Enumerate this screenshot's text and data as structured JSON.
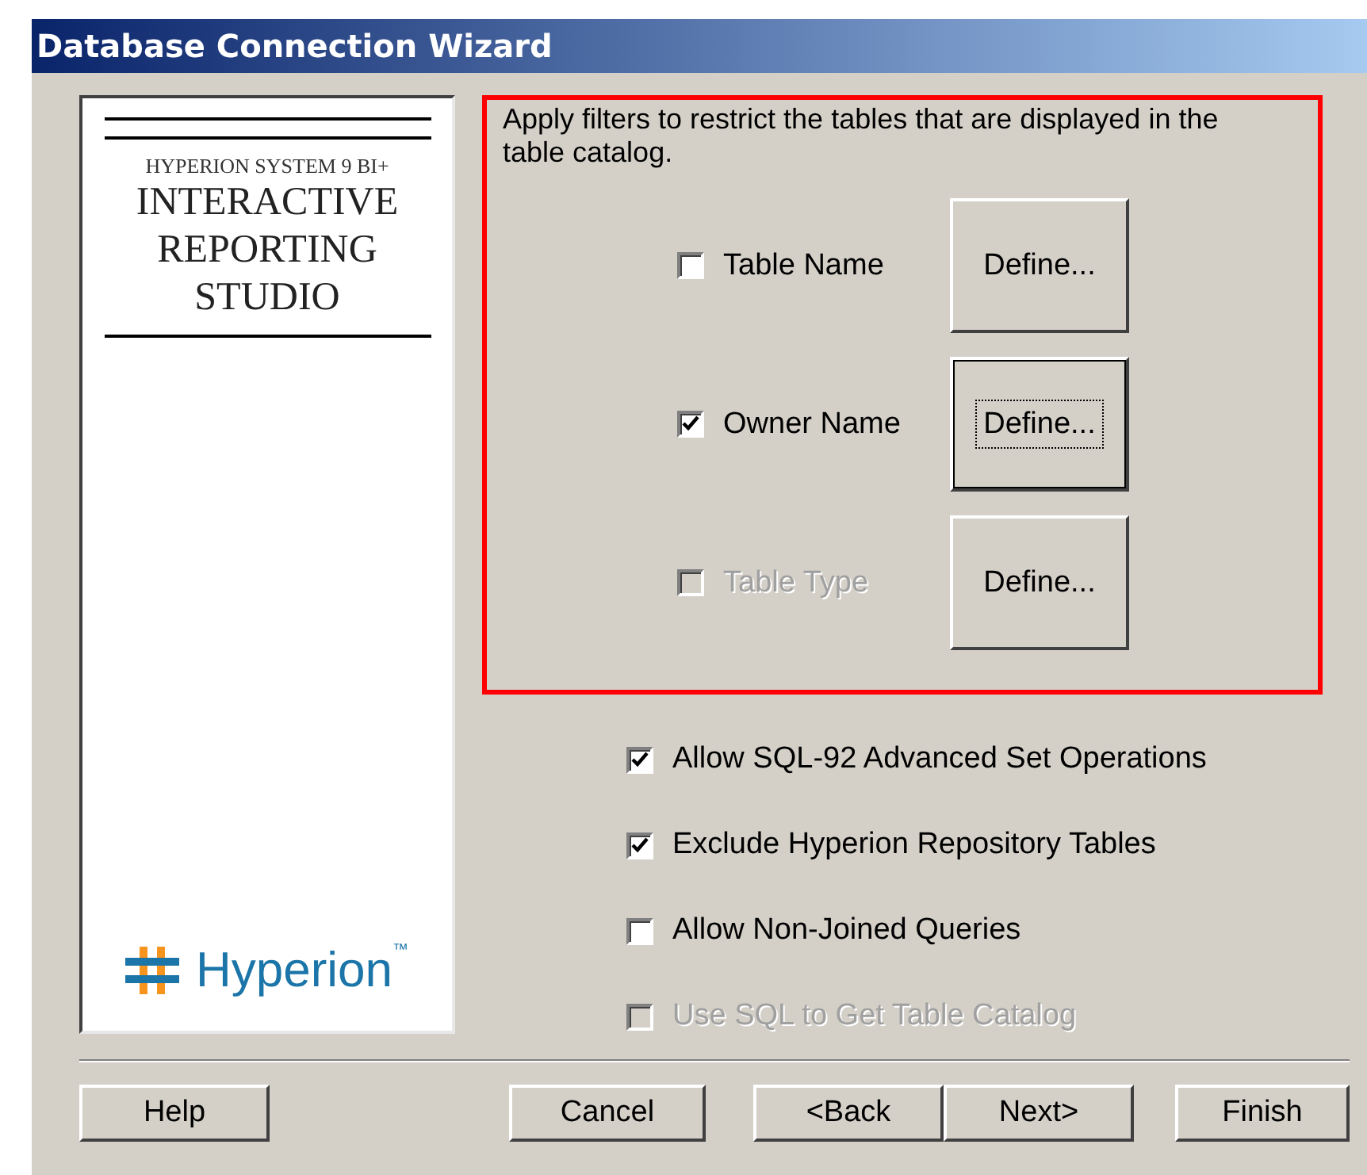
{
  "window": {
    "title": "Database Connection Wizard"
  },
  "logo": {
    "subtitle": "HYPERION SYSTEM 9 BI+",
    "product_lines": [
      "INTERACTIVE",
      "REPORTING",
      "STUDIO"
    ],
    "brand": "Hyperion",
    "trademark": "™"
  },
  "filters": {
    "description": "Apply filters to restrict the tables that are displayed in the table catalog.",
    "items": [
      {
        "label": "Table Name",
        "checked": false,
        "disabled": false,
        "button": {
          "label": "Define...",
          "focused": false
        }
      },
      {
        "label": "Owner Name",
        "checked": true,
        "disabled": false,
        "button": {
          "label": "Define...",
          "focused": true
        }
      },
      {
        "label": "Table Type",
        "checked": false,
        "disabled": true,
        "button": {
          "label": "Define...",
          "focused": false
        }
      }
    ]
  },
  "options": [
    {
      "label": "Allow SQL-92 Advanced Set Operations",
      "checked": true,
      "disabled": false
    },
    {
      "label": "Exclude Hyperion Repository Tables",
      "checked": true,
      "disabled": false
    },
    {
      "label": "Allow Non-Joined Queries",
      "checked": false,
      "disabled": false
    },
    {
      "label": "Use SQL to Get Table Catalog",
      "checked": false,
      "disabled": true
    }
  ],
  "left_buttons": [
    {
      "label": "Help"
    }
  ],
  "right_buttons": [
    {
      "label": "Cancel"
    },
    {
      "label": "<Back"
    },
    {
      "label": "Next>"
    },
    {
      "label": "Finish"
    }
  ]
}
